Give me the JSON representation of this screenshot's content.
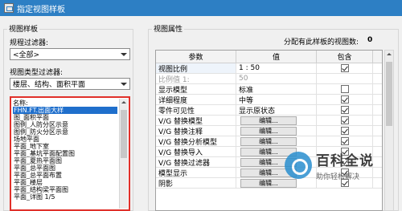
{
  "window": {
    "title": "指定视图样板"
  },
  "left_panel": {
    "group_title": "视图样板",
    "discipline_filter": {
      "label": "规程过滤器:",
      "value": "<全部>"
    },
    "view_type_filter": {
      "label": "视图类型过滤器:",
      "value": "楼层、结构、面积平面"
    },
    "names": {
      "label": "名称:",
      "items": [
        {
          "text": "FHN.FT.出面大样",
          "selected": true
        },
        {
          "text": "图_面积平面",
          "selected": false
        },
        {
          "text": "图例_人防分区示意",
          "selected": false
        },
        {
          "text": "图例_防火分区示意",
          "selected": false
        },
        {
          "text": "场地平面",
          "selected": false
        },
        {
          "text": "平面_地下室",
          "selected": false
        },
        {
          "text": "平面_基坑平面配置图",
          "selected": false
        },
        {
          "text": "平面_夏热平面图",
          "selected": false
        },
        {
          "text": "平面_总平面图",
          "selected": false
        },
        {
          "text": "平面_总平面布置",
          "selected": false
        },
        {
          "text": "平面_楼层",
          "selected": false
        },
        {
          "text": "平面_结构梁平面图",
          "selected": false
        },
        {
          "text": "平面_详图 1/5",
          "selected": false
        }
      ]
    }
  },
  "right_panel": {
    "group_title": "视图属性",
    "assigned_count_label": "分配有此样板的视图数:",
    "assigned_count": "0",
    "columns": [
      "参数",
      "值",
      "包含"
    ],
    "rows": [
      {
        "param": "视图比例",
        "value": "1 : 50",
        "type": "text",
        "include": true,
        "disabled": false,
        "highlight": true
      },
      {
        "param": "比例值 1:",
        "value": "50",
        "type": "text",
        "include": null,
        "disabled": true,
        "highlight": false
      },
      {
        "param": "显示模型",
        "value": "标准",
        "type": "text",
        "include": false,
        "disabled": false,
        "highlight": false
      },
      {
        "param": "详细程度",
        "value": "中等",
        "type": "text",
        "include": true,
        "disabled": false,
        "highlight": false
      },
      {
        "param": "零件可见性",
        "value": "显示原状态",
        "type": "text",
        "include": true,
        "disabled": false,
        "highlight": false
      },
      {
        "param": "V/G 替换模型",
        "value": "编辑...",
        "type": "button",
        "include": true,
        "disabled": false,
        "highlight": false
      },
      {
        "param": "V/G 替换注释",
        "value": "编辑...",
        "type": "button",
        "include": true,
        "disabled": false,
        "highlight": false
      },
      {
        "param": "V/G 替换分析模型",
        "value": "编辑...",
        "type": "button",
        "include": true,
        "disabled": false,
        "highlight": false
      },
      {
        "param": "V/G 替换导入",
        "value": "编辑...",
        "type": "button",
        "include": true,
        "disabled": false,
        "highlight": false
      },
      {
        "param": "V/G 替换过滤器",
        "value": "编辑...",
        "type": "button",
        "include": true,
        "disabled": false,
        "highlight": false
      },
      {
        "param": "模型显示",
        "value": "编辑...",
        "type": "button",
        "include": true,
        "disabled": false,
        "highlight": false
      },
      {
        "param": "阴影",
        "value": "编辑...",
        "type": "button",
        "include": true,
        "disabled": false,
        "highlight": false
      }
    ]
  },
  "watermark": {
    "main": "百科全说",
    "sub": "助你轻松解决"
  }
}
